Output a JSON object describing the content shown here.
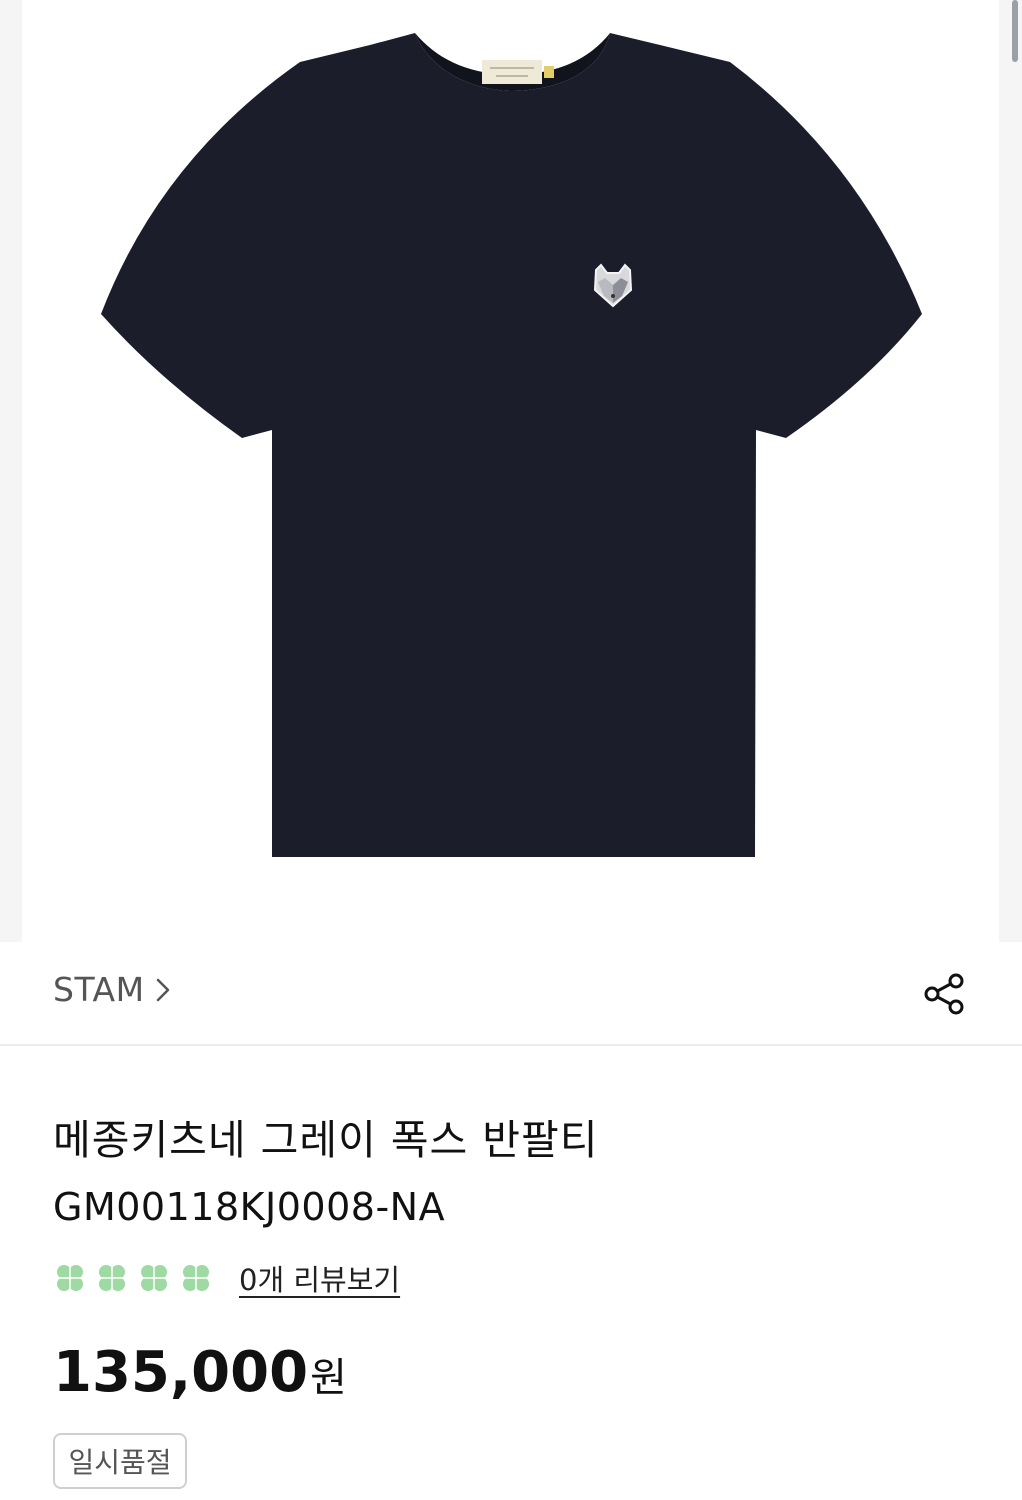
{
  "product": {
    "brand": "STAM",
    "title": "메종키츠네 그레이 폭스 반팔티",
    "code": "GM00118KJ0008-NA",
    "review_link": "0개 리뷰보기",
    "rating": 0,
    "rating_max": 4,
    "price_value": "135,000",
    "price_unit": "원",
    "status_badge": "일시품절"
  },
  "icons": {
    "brand_chevron": "chevron-right-icon",
    "share": "share-icon",
    "rating": "clover-icon"
  },
  "colors": {
    "shirt": "#1b1d2b",
    "clover_empty": "#9fd9a3",
    "divider": "#ececec"
  }
}
